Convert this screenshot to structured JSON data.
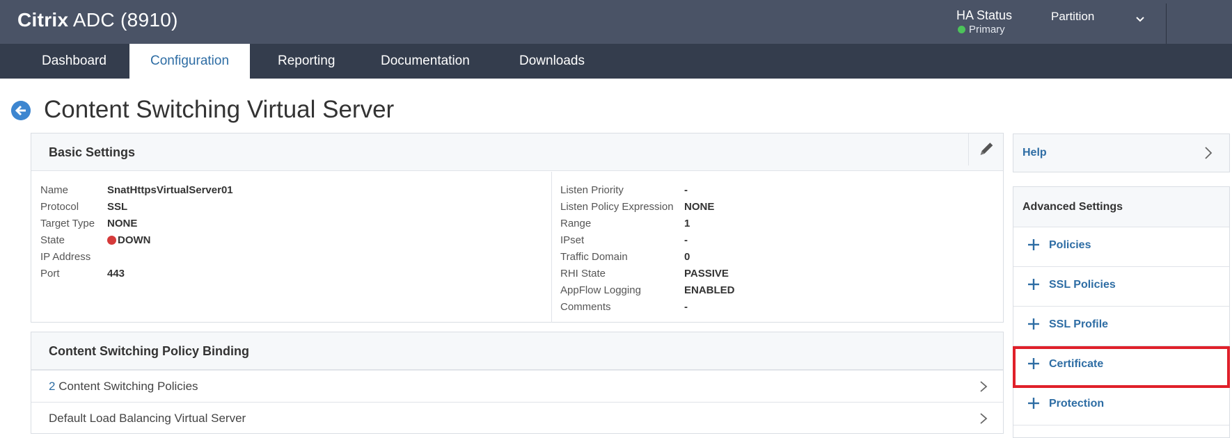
{
  "header": {
    "brand_name": "Citrix",
    "brand_model": "ADC (8910)",
    "ha_status_label": "HA Status",
    "ha_status_value": "Primary",
    "partition_label": "Partition"
  },
  "nav": {
    "tabs": [
      {
        "label": "Dashboard"
      },
      {
        "label": "Configuration"
      },
      {
        "label": "Reporting"
      },
      {
        "label": "Documentation"
      },
      {
        "label": "Downloads"
      }
    ],
    "active": "Configuration"
  },
  "page": {
    "title": "Content Switching Virtual Server"
  },
  "basic_settings": {
    "title": "Basic Settings",
    "left": [
      {
        "label": "Name",
        "value": "SnatHttpsVirtualServer01"
      },
      {
        "label": "Protocol",
        "value": "SSL"
      },
      {
        "label": "Target Type",
        "value": "NONE"
      },
      {
        "label": "State",
        "value": "DOWN"
      },
      {
        "label": "IP Address",
        "value": ""
      },
      {
        "label": "Port",
        "value": "443"
      }
    ],
    "right": [
      {
        "label": "Listen Priority",
        "value": "-"
      },
      {
        "label": "Listen Policy Expression",
        "value": "NONE"
      },
      {
        "label": "Range",
        "value": "1"
      },
      {
        "label": "IPset",
        "value": "-"
      },
      {
        "label": "Traffic Domain",
        "value": "0"
      },
      {
        "label": "RHI State",
        "value": "PASSIVE"
      },
      {
        "label": "AppFlow Logging",
        "value": "ENABLED"
      },
      {
        "label": "Comments",
        "value": "-"
      }
    ]
  },
  "policy_binding": {
    "title": "Content Switching Policy Binding",
    "rows": [
      {
        "count": "2",
        "label": "Content Switching Policies"
      },
      {
        "label": "Default Load Balancing Virtual Server"
      }
    ]
  },
  "sidebar": {
    "help_label": "Help",
    "advanced_title": "Advanced Settings",
    "items": [
      {
        "label": "Policies"
      },
      {
        "label": "SSL Policies"
      },
      {
        "label": "SSL Profile"
      },
      {
        "label": "Certificate"
      },
      {
        "label": "Protection"
      }
    ]
  },
  "colors": {
    "header_bg": "#4a5366",
    "nav_bg": "#343d4d",
    "link_blue": "#2e6da4",
    "state_down": "#d53a3a",
    "ha_primary": "#4cc35a",
    "highlight": "#e0202a"
  }
}
